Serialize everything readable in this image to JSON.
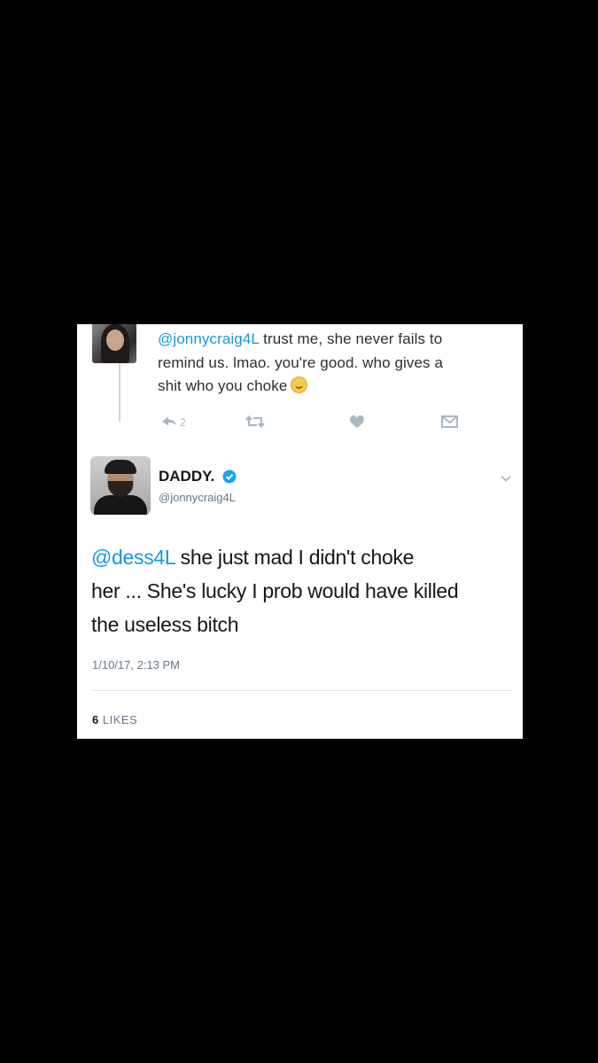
{
  "reply": {
    "mention": "@jonnycraig4L",
    "line1_rest": " trust me, she never fails to",
    "line2": "remind us. lmao. you're good. who gives a",
    "line3": "shit who you choke",
    "emoji_name": "upside-down-face-emoji",
    "actions": {
      "reply_count": "2"
    }
  },
  "tweet": {
    "display_name": "DADDY.",
    "handle": "@jonnycraig4L",
    "mention": "@dess4L",
    "text_line1_rest": " she just mad I didn't choke",
    "text_line2": "her ... She's lucky I prob would have killed",
    "text_line3": "the useless bitch",
    "timestamp": "1/10/17, 2:13 PM",
    "likes_count": "6",
    "likes_label": " LIKES"
  },
  "colors": {
    "background": "#000000",
    "card": "#ffffff",
    "link": "#1b95e0",
    "icon": "#aab8c2",
    "verified": "#1da1f2"
  },
  "icons": [
    "reply-icon",
    "retweet-icon",
    "like-icon",
    "direct-message-icon",
    "verified-badge-icon",
    "chevron-down-icon"
  ]
}
